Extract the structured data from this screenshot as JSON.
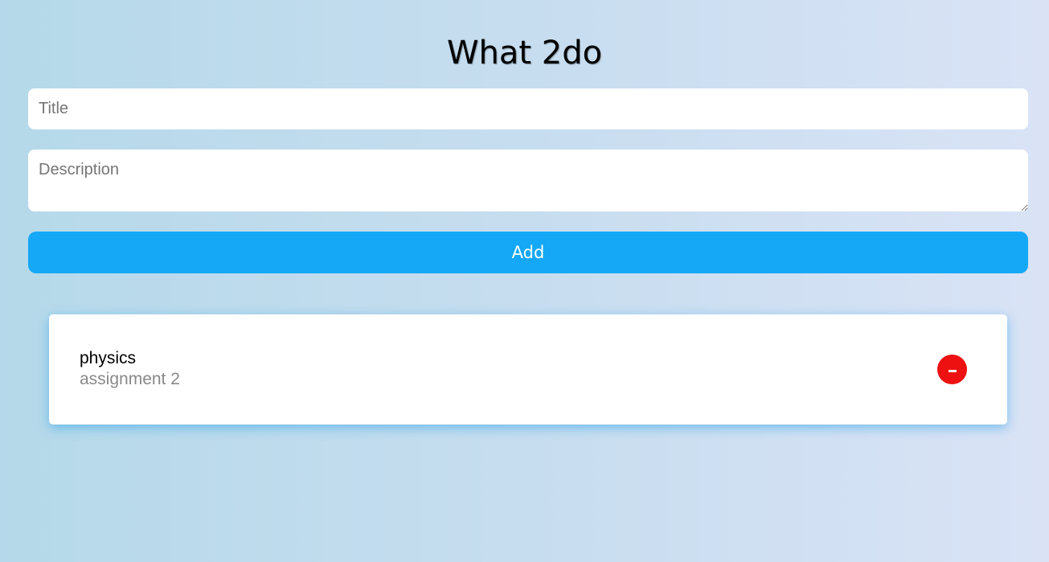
{
  "app": {
    "title": "What 2do"
  },
  "form": {
    "title_placeholder": "Title",
    "title_value": "",
    "description_placeholder": "Description",
    "description_value": "",
    "add_label": "Add"
  },
  "todos": [
    {
      "title": "physics",
      "description": "assignment 2"
    }
  ],
  "icons": {
    "delete": "minus-icon"
  },
  "colors": {
    "accent": "#15a8f6",
    "delete": "#ee1111"
  }
}
